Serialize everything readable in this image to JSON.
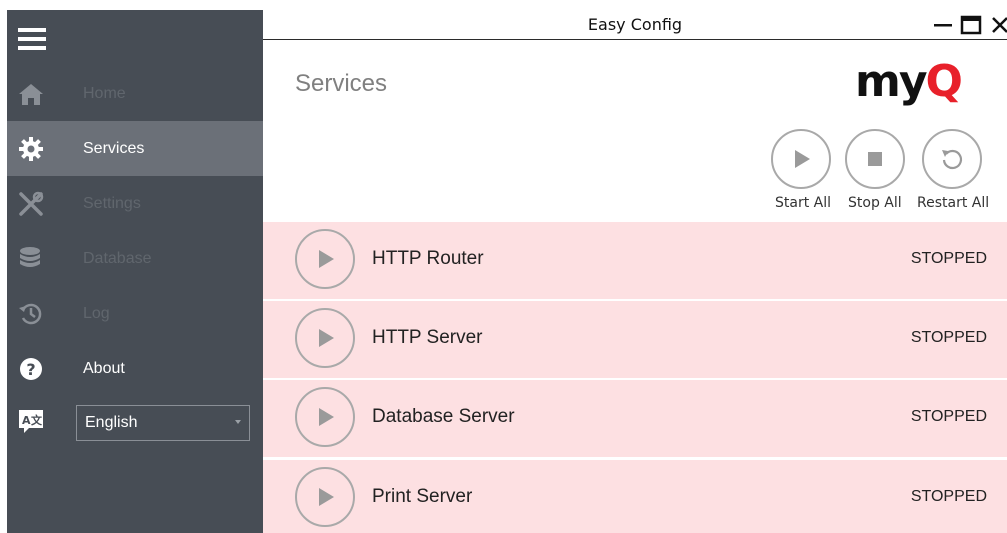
{
  "window": {
    "title": "Easy Config"
  },
  "sidebar": {
    "items": [
      {
        "label": "Home",
        "icon": "home-icon",
        "state": "disabled"
      },
      {
        "label": "Services",
        "icon": "gear-icon",
        "state": "active"
      },
      {
        "label": "Settings",
        "icon": "wrench-icon",
        "state": "disabled"
      },
      {
        "label": "Database",
        "icon": "database-icon",
        "state": "disabled"
      },
      {
        "label": "Log",
        "icon": "history-icon",
        "state": "disabled"
      },
      {
        "label": "About",
        "icon": "help-icon",
        "state": "enabled"
      }
    ],
    "language": {
      "icon": "language-icon",
      "value": "English"
    }
  },
  "main": {
    "title": "Services",
    "logo": {
      "text_main": "my",
      "text_accent": "Q",
      "accent_color": "#e8202a"
    },
    "controls": {
      "start_all": "Start All",
      "stop_all": "Stop All",
      "restart_all": "Restart All"
    },
    "services": [
      {
        "name": "HTTP Router",
        "status": "STOPPED"
      },
      {
        "name": "HTTP Server",
        "status": "STOPPED"
      },
      {
        "name": "Database Server",
        "status": "STOPPED"
      },
      {
        "name": "Print Server",
        "status": "STOPPED"
      }
    ]
  },
  "colors": {
    "sidebar_bg": "#474d55",
    "sidebar_active": "#6b7078",
    "stopped_row_bg": "#fde0e2"
  }
}
